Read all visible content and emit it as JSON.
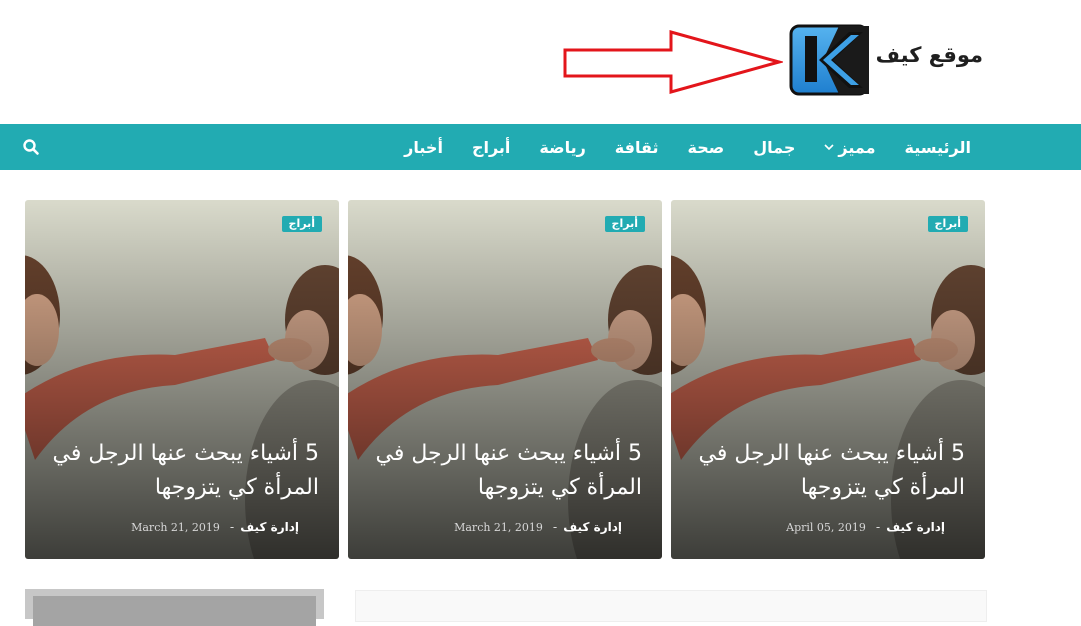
{
  "logo": {
    "letter": "K",
    "text": "موقع كيف"
  },
  "nav": {
    "items": [
      {
        "label": "الرئيسية",
        "has_dropdown": false
      },
      {
        "label": "مميز",
        "has_dropdown": true
      },
      {
        "label": "جمال",
        "has_dropdown": false
      },
      {
        "label": "صحة",
        "has_dropdown": false
      },
      {
        "label": "ثقافة",
        "has_dropdown": false
      },
      {
        "label": "رياضة",
        "has_dropdown": false
      },
      {
        "label": "أبراج",
        "has_dropdown": false
      },
      {
        "label": "أخبار",
        "has_dropdown": false
      }
    ],
    "search_icon": "search-icon"
  },
  "cards": [
    {
      "category": "أبراج",
      "title": "5 أشياء يبحث عنها الرجل في المرأة كي يتزوجها",
      "author": "إدارة كيف",
      "separator": "-",
      "date": "April 05, 2019"
    },
    {
      "category": "أبراج",
      "title": "5 أشياء يبحث عنها الرجل في المرأة كي يتزوجها",
      "author": "إدارة كيف",
      "separator": "-",
      "date": "March 21, 2019"
    },
    {
      "category": "أبراج",
      "title": "5 أشياء يبحث عنها الرجل في المرأة كي يتزوجها",
      "author": "إدارة كيف",
      "separator": "-",
      "date": "March 21, 2019"
    }
  ],
  "colors": {
    "accent": "#22abb2",
    "logo_blue": "#2f8fd8",
    "arrow_red": "#e3151b",
    "sleeve": "#e8735a",
    "photo_bg": "#d9dacb"
  }
}
